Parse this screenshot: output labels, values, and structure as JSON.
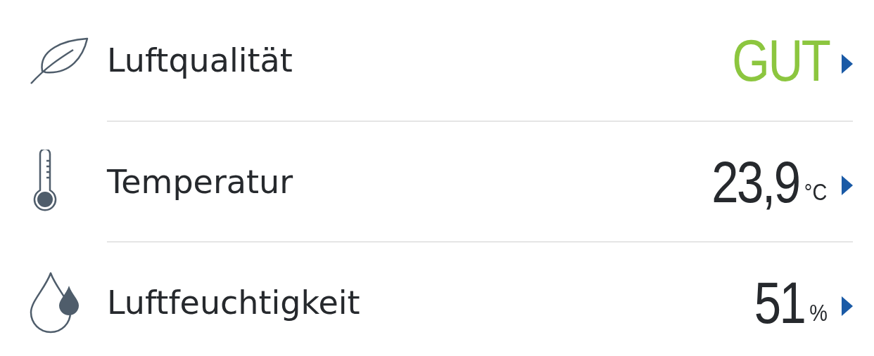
{
  "rows": [
    {
      "kind": "leaf",
      "label": "Luftqualität",
      "value": "GUT",
      "color": "#8cc63f"
    },
    {
      "kind": "thermometer",
      "label": "Temperatur",
      "value": "23,9",
      "unit": "°C",
      "color": "#26292d"
    },
    {
      "kind": "drops",
      "label": "Luftfeuchtigkeit",
      "value": "51",
      "unit": "%",
      "color": "#26292d"
    }
  ]
}
